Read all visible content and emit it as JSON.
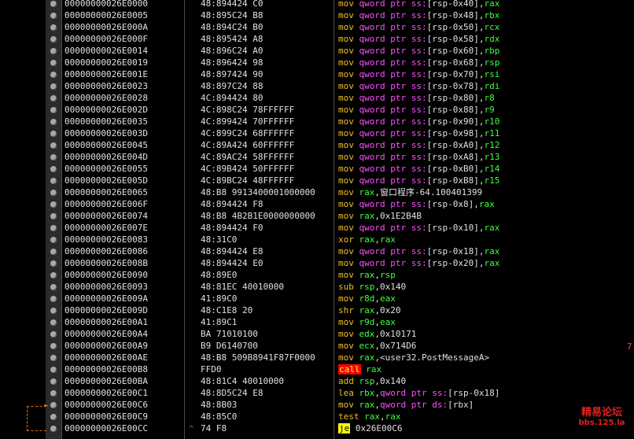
{
  "rows": [
    {
      "addr": "00000000026E0000",
      "bytes": "48:894424 C0",
      "mn": "mov",
      "ptr": "qword ptr ss:",
      "op": "[rsp-0x40]",
      "r": "rax"
    },
    {
      "addr": "00000000026E0005",
      "bytes": "48:895C24 B8",
      "mn": "mov",
      "ptr": "qword ptr ss:",
      "op": "[rsp-0x48]",
      "r": "rbx"
    },
    {
      "addr": "00000000026E000A",
      "bytes": "48:894C24 B0",
      "mn": "mov",
      "ptr": "qword ptr ss:",
      "op": "[rsp-0x50]",
      "r": "rcx"
    },
    {
      "addr": "00000000026E000F",
      "bytes": "48:895424 A8",
      "mn": "mov",
      "ptr": "qword ptr ss:",
      "op": "[rsp-0x58]",
      "r": "rdx"
    },
    {
      "addr": "00000000026E0014",
      "bytes": "48:896C24 A0",
      "mn": "mov",
      "ptr": "qword ptr ss:",
      "op": "[rsp-0x60]",
      "r": "rbp"
    },
    {
      "addr": "00000000026E0019",
      "bytes": "48:896424 98",
      "mn": "mov",
      "ptr": "qword ptr ss:",
      "op": "[rsp-0x68]",
      "r": "rsp"
    },
    {
      "addr": "00000000026E001E",
      "bytes": "48:897424 90",
      "mn": "mov",
      "ptr": "qword ptr ss:",
      "op": "[rsp-0x70]",
      "r": "rsi"
    },
    {
      "addr": "00000000026E0023",
      "bytes": "48:897C24 88",
      "mn": "mov",
      "ptr": "qword ptr ss:",
      "op": "[rsp-0x78]",
      "r": "rdi"
    },
    {
      "addr": "00000000026E0028",
      "bytes": "4C:894424 80",
      "mn": "mov",
      "ptr": "qword ptr ss:",
      "op": "[rsp-0x80]",
      "r": "r8"
    },
    {
      "addr": "00000000026E002D",
      "bytes": "4C:898C24 78FFFFFF",
      "mn": "mov",
      "ptr": "qword ptr ss:",
      "op": "[rsp-0x88]",
      "r": "r9"
    },
    {
      "addr": "00000000026E0035",
      "bytes": "4C:899424 70FFFFFF",
      "mn": "mov",
      "ptr": "qword ptr ss:",
      "op": "[rsp-0x90]",
      "r": "r10"
    },
    {
      "addr": "00000000026E003D",
      "bytes": "4C:899C24 68FFFFFF",
      "mn": "mov",
      "ptr": "qword ptr ss:",
      "op": "[rsp-0x98]",
      "r": "r11"
    },
    {
      "addr": "00000000026E0045",
      "bytes": "4C:89A424 60FFFFFF",
      "mn": "mov",
      "ptr": "qword ptr ss:",
      "op": "[rsp-0xA0]",
      "r": "r12"
    },
    {
      "addr": "00000000026E004D",
      "bytes": "4C:89AC24 58FFFFFF",
      "mn": "mov",
      "ptr": "qword ptr ss:",
      "op": "[rsp-0xA8]",
      "r": "r13"
    },
    {
      "addr": "00000000026E0055",
      "bytes": "4C:89B424 50FFFFFF",
      "mn": "mov",
      "ptr": "qword ptr ss:",
      "op": "[rsp-0xB0]",
      "r": "r14"
    },
    {
      "addr": "00000000026E005D",
      "bytes": "4C:89BC24 48FFFFFF",
      "mn": "mov",
      "ptr": "qword ptr ss:",
      "op": "[rsp-0xB8]",
      "r": "r15"
    },
    {
      "addr": "00000000026E0065",
      "bytes": "48:B8 9913400001000000",
      "mn": "mov",
      "r1": "rax",
      "val": ",窗口程序-64.100401399"
    },
    {
      "addr": "00000000026E006F",
      "bytes": "48:894424 F8",
      "mn": "mov",
      "ptr": "qword ptr ss:",
      "op": "[rsp-0x8]",
      "r": "rax"
    },
    {
      "addr": "00000000026E0074",
      "bytes": "48:B8 4B2B1E0000000000",
      "mn": "mov",
      "r1": "rax",
      "val": ",0x1E2B4B"
    },
    {
      "addr": "00000000026E007E",
      "bytes": "48:894424 F0",
      "mn": "mov",
      "ptr": "qword ptr ss:",
      "op": "[rsp-0x10]",
      "r": "rax"
    },
    {
      "addr": "00000000026E0083",
      "bytes": "48:31C0",
      "mn": "xor",
      "r1": "rax",
      "r2": "rax"
    },
    {
      "addr": "00000000026E0086",
      "bytes": "48:894424 E8",
      "mn": "mov",
      "ptr": "qword ptr ss:",
      "op": "[rsp-0x18]",
      "r": "rax"
    },
    {
      "addr": "00000000026E008B",
      "bytes": "48:894424 E0",
      "mn": "mov",
      "ptr": "qword ptr ss:",
      "op": "[rsp-0x20]",
      "r": "rax"
    },
    {
      "addr": "00000000026E0090",
      "bytes": "48:89E0",
      "mn": "mov",
      "r1": "rax",
      "r2": "rsp"
    },
    {
      "addr": "00000000026E0093",
      "bytes": "48:81EC 40010000",
      "mn": "sub",
      "r1": "rsp",
      "val": ",0x140"
    },
    {
      "addr": "00000000026E009A",
      "bytes": "41:89C0",
      "mn": "mov",
      "r1": "r8d",
      "r2": "eax"
    },
    {
      "addr": "00000000026E009D",
      "bytes": "48:C1E8 20",
      "mn": "shr",
      "r1": "rax",
      "val": ",0x20"
    },
    {
      "addr": "00000000026E00A1",
      "bytes": "41:89C1",
      "mn": "mov",
      "r1": "r9d",
      "r2": "eax"
    },
    {
      "addr": "00000000026E00A4",
      "bytes": "BA 71010100",
      "mn": "mov",
      "r1": "edx",
      "val": ",0x10171"
    },
    {
      "addr": "00000000026E00A9",
      "bytes": "B9 D6140700",
      "mn": "mov",
      "r1": "ecx",
      "val": ",0x714D6"
    },
    {
      "addr": "00000000026E00AE",
      "bytes": "48:B8 509B8941F87F0000",
      "mn": "mov",
      "r1": "rax",
      "val": ",<user32.PostMessageA>"
    },
    {
      "addr": "00000000026E00B8",
      "bytes": "FFD0",
      "mn": "call",
      "r1": "rax",
      "special": "call"
    },
    {
      "addr": "00000000026E00BA",
      "bytes": "48:81C4 40010000",
      "mn": "add",
      "r1": "rsp",
      "val": ",0x140"
    },
    {
      "addr": "00000000026E00C1",
      "bytes": "48:8D5C24 E8",
      "mn": "lea",
      "r1": "rbx",
      "ptr2": "qword ptr ss:",
      "op2": "[rsp-0x18]"
    },
    {
      "addr": "00000000026E00C6",
      "bytes": "48:8B03",
      "mn": "mov",
      "r1": "rax",
      "ptr2": "qword ptr ds:",
      "op2": "[rbx]"
    },
    {
      "addr": "00000000026E00C9",
      "bytes": "48:85C0",
      "mn": "test",
      "r1": "rax",
      "r2": "rax"
    },
    {
      "addr": "00000000026E00CC",
      "bytes": "74 F8",
      "mn": "je",
      "val": "0x26E00C6",
      "special": "je"
    }
  ],
  "side_marks": {
    "right_digit": "7",
    "jump_arrow": "^"
  },
  "watermark": {
    "line1": "精易论坛",
    "line2": "bbs.125.la"
  },
  "colors": {
    "mnemonic": "#f0c020",
    "keyword": "#ff50ff",
    "register": "#40ff40",
    "call_bg": "#ff0000",
    "je_bg": "#ffff00"
  }
}
